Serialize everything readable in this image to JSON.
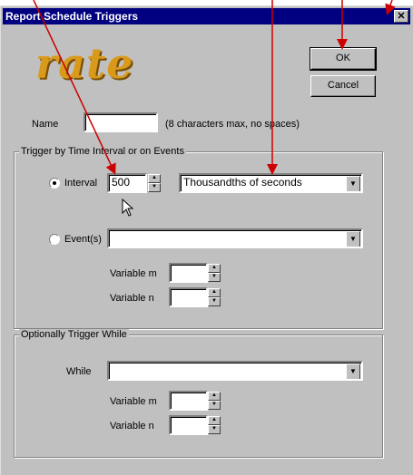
{
  "window": {
    "title": "Report Schedule Triggers",
    "close_glyph": "✕"
  },
  "logo": {
    "text": "rate"
  },
  "buttons": {
    "ok": "OK",
    "cancel": "Cancel"
  },
  "name_field": {
    "label": "Name",
    "value": "",
    "hint": "(8 characters max, no spaces)"
  },
  "trigger_group": {
    "title": "Trigger by Time Interval or on Events",
    "interval_label": "Interval",
    "interval_value": "500",
    "interval_unit": "Thousandths of seconds",
    "events_label": "Event(s)",
    "events_value": "",
    "variable_m_label": "Variable m",
    "variable_n_label": "Variable n",
    "variable_m_value": "",
    "variable_n_value": ""
  },
  "while_group": {
    "title": "Optionally Trigger While",
    "while_label": "While",
    "while_value": "",
    "variable_m_label": "Variable m",
    "variable_n_label": "Variable n",
    "variable_m_value": "",
    "variable_n_value": ""
  },
  "icons": {
    "spin_up": "▲",
    "spin_down": "▼",
    "dropdown": "▼",
    "cursor": "pointer-arrow-icon"
  },
  "colors": {
    "titlebar": "#000080",
    "dialog": "#c0c0c0",
    "logo": "#d99a1c",
    "annotation": "#cc0000"
  }
}
